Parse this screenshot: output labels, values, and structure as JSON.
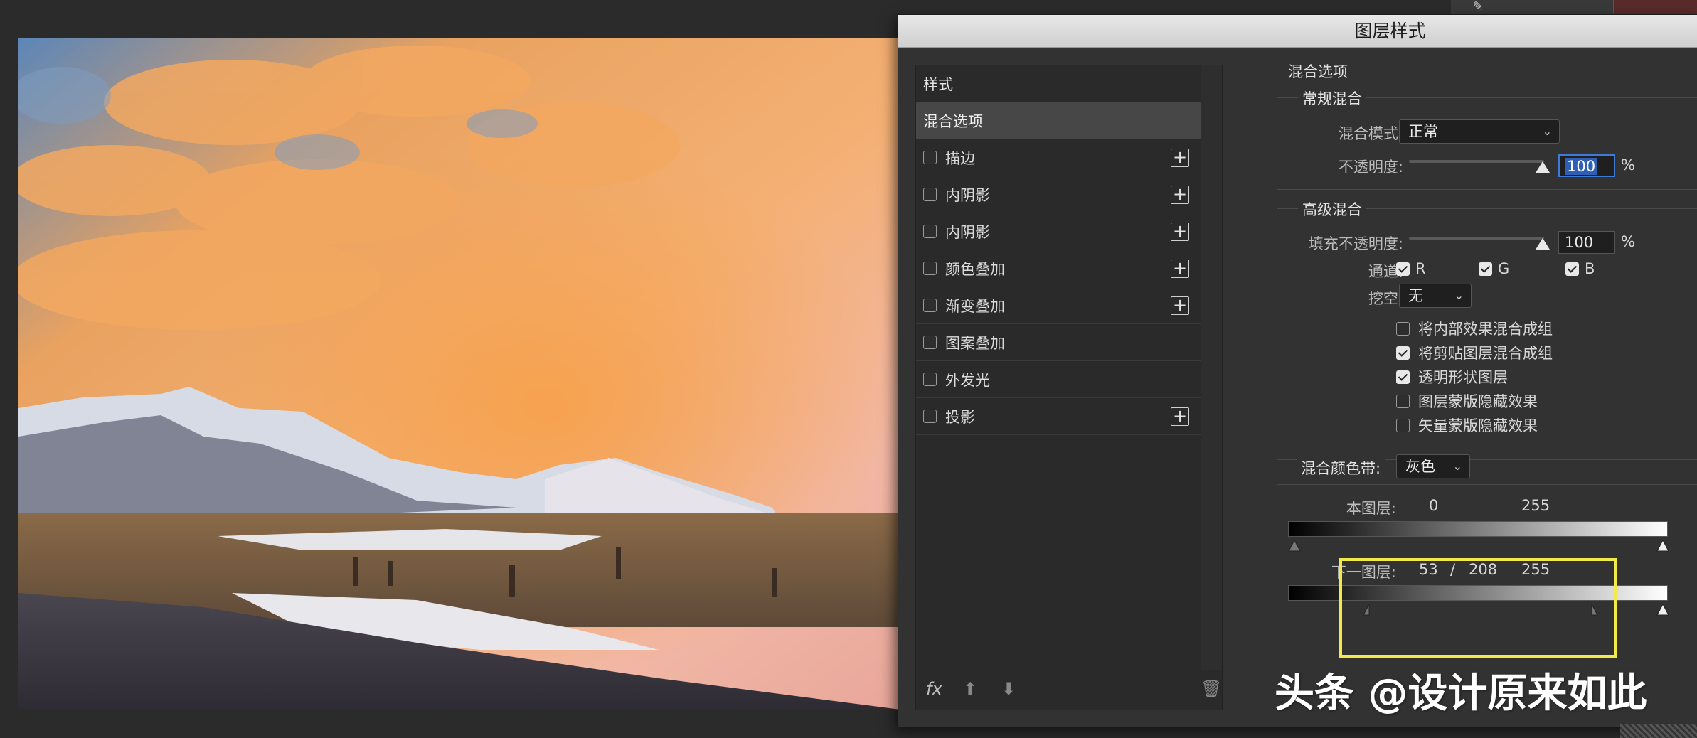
{
  "dialog": {
    "title": "图层样式"
  },
  "styles_list": {
    "header": "样式",
    "selected": "混合选项",
    "items": [
      {
        "label": "描边",
        "checked": false,
        "has_plus": true
      },
      {
        "label": "内阴影",
        "checked": false,
        "has_plus": true
      },
      {
        "label": "内阴影",
        "checked": false,
        "has_plus": true
      },
      {
        "label": "颜色叠加",
        "checked": false,
        "has_plus": true
      },
      {
        "label": "渐变叠加",
        "checked": false,
        "has_plus": true
      },
      {
        "label": "图案叠加",
        "checked": false,
        "has_plus": false
      },
      {
        "label": "外发光",
        "checked": false,
        "has_plus": false
      },
      {
        "label": "投影",
        "checked": false,
        "has_plus": true
      }
    ],
    "footer": {
      "fx": "fx",
      "fx_icon": "fx-menu-icon",
      "up_icon": "arrow-up-icon",
      "down_icon": "arrow-down-icon",
      "trash_icon": "trash-icon"
    }
  },
  "blend": {
    "section_title": "混合选项",
    "general": {
      "title": "常规混合",
      "mode_label": "混合模式:",
      "mode_value": "正常",
      "opacity_label": "不透明度:",
      "opacity_value": "100",
      "percent": "%"
    },
    "advanced": {
      "title": "高级混合",
      "fill_label": "填充不透明度:",
      "fill_value": "100",
      "percent": "%",
      "channels_label": "通道:",
      "channel_r": "R",
      "channel_g": "G",
      "channel_b": "B",
      "knockout_label": "挖空:",
      "knockout_value": "无",
      "options": [
        {
          "label": "将内部效果混合成组",
          "checked": false
        },
        {
          "label": "将剪贴图层混合成组",
          "checked": true
        },
        {
          "label": "透明形状图层",
          "checked": true
        },
        {
          "label": "图层蒙版隐藏效果",
          "checked": false
        },
        {
          "label": "矢量蒙版隐藏效果",
          "checked": false
        }
      ]
    },
    "blend_if": {
      "label": "混合颜色带:",
      "value": "灰色",
      "this_layer_label": "本图层:",
      "this_low": "0",
      "this_high": "255",
      "under_layer_label": "下一图层:",
      "under_low": "53",
      "under_sep": "/",
      "under_mid": "208",
      "under_high": "255"
    }
  },
  "highlight_color": "#f0ea4a",
  "watermark": "头条 @设计原来如此"
}
